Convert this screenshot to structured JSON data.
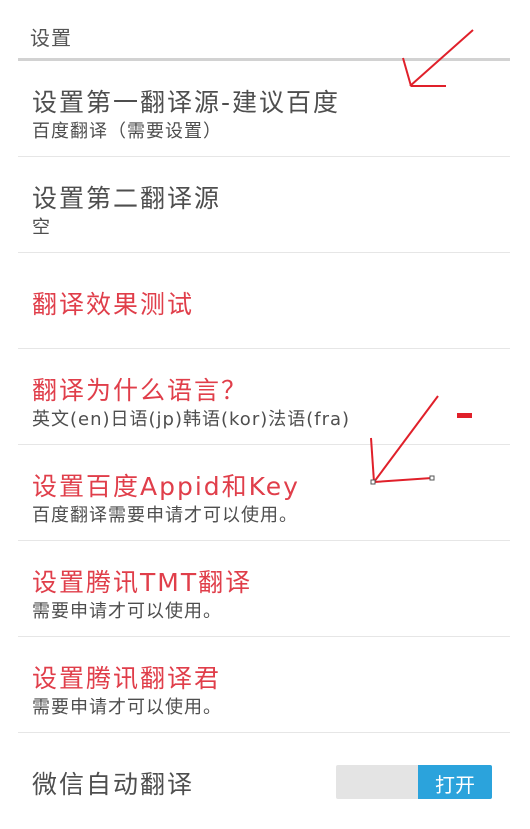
{
  "header": {
    "title": "设置"
  },
  "items": [
    {
      "title": "设置第一翻译源-建议百度",
      "subtitle": "百度翻译（需要设置）",
      "title_color": "gray"
    },
    {
      "title": "设置第二翻译源",
      "subtitle": "空",
      "title_color": "gray"
    },
    {
      "title": "翻译效果测试",
      "subtitle": "",
      "title_color": "red"
    },
    {
      "title": "翻译为什么语言？",
      "subtitle": "英文(en)日语(jp)韩语(kor)法语(fra)",
      "title_color": "red"
    },
    {
      "title": "设置百度Appid和Key",
      "subtitle": "百度翻译需要申请才可以使用。",
      "title_color": "red"
    },
    {
      "title": "设置腾讯TMT翻译",
      "subtitle": "需要申请才可以使用。",
      "title_color": "red"
    },
    {
      "title": "设置腾讯翻译君",
      "subtitle": "需要申请才可以使用。",
      "title_color": "red"
    },
    {
      "title": "微信自动翻译",
      "subtitle": ""
    }
  ],
  "toggle": {
    "on_label": "打开"
  },
  "colors": {
    "accent_red": "#e03e4a",
    "toggle_blue": "#2ba3dc",
    "annotation_red": "#e0202a"
  },
  "annotations": [
    "arrow",
    "arrow",
    "dash"
  ]
}
